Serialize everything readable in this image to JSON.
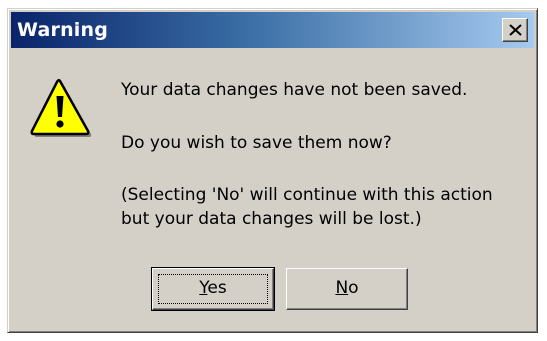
{
  "window": {
    "title": "Warning",
    "close_icon": "close-icon"
  },
  "icon": {
    "name": "warning-icon",
    "fill": "#ffff00",
    "outline": "#000000"
  },
  "message": {
    "line1": "Your data changes have not been saved.",
    "line2": "Do you wish to save them now?",
    "line3": "(Selecting 'No' will continue with this action",
    "line4": "but your data changes will be lost.)"
  },
  "buttons": {
    "yes_mnemonic": "Y",
    "yes_rest": "es",
    "no_mnemonic": "N",
    "no_rest": "o"
  },
  "colors": {
    "title_gradient_start": "#0a246a",
    "title_gradient_end": "#a6caf0",
    "face": "#d4d0c8"
  }
}
